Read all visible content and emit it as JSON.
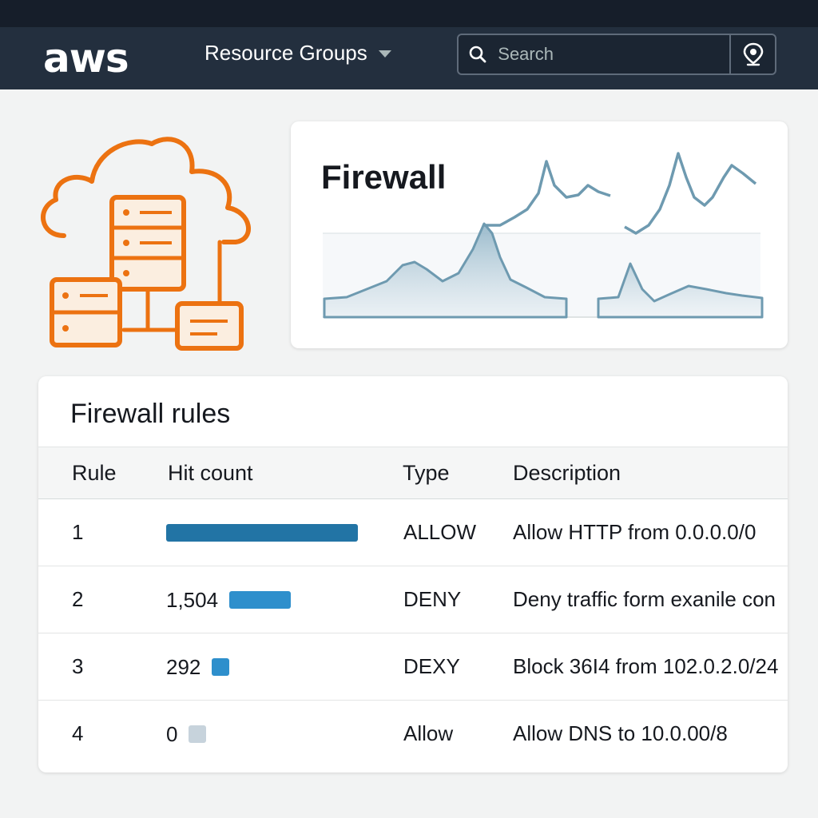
{
  "header": {
    "logo": "aws",
    "resource_groups_label": "Resource Groups",
    "search_placeholder": "Search"
  },
  "firewall_card": {
    "title": "Firewall"
  },
  "rules_table": {
    "title": "Firewall rules",
    "columns": [
      "Rule",
      "Hit count",
      "Type",
      "Description"
    ],
    "rows": [
      {
        "rule": "1",
        "hit_count": "",
        "hit_fraction": 1.0,
        "hit_color": "#2274a5",
        "type": "ALLOW",
        "description": "Allow HTTP from 0.0.0.0/0"
      },
      {
        "rule": "2",
        "hit_count": "1,504",
        "hit_fraction": 0.32,
        "hit_color": "#2e8fcc",
        "type": "DENY",
        "description": "Deny traffic form exanile con"
      },
      {
        "rule": "3",
        "hit_count": "292",
        "hit_fraction": 0.09,
        "hit_color": "#2e8fcc",
        "type": "DEXY",
        "description": "Block 36I4 from 102.0.2.0/24"
      },
      {
        "rule": "4",
        "hit_count": "0",
        "hit_fraction": 0.09,
        "hit_color": "#c7d3dc",
        "type": "Allow",
        "description": "Allow DNS to 10.0.00/8"
      }
    ]
  },
  "colors": {
    "header_bg": "#232f3e",
    "accent_orange": "#ec7211",
    "chart_line": "#6e9ab0"
  }
}
